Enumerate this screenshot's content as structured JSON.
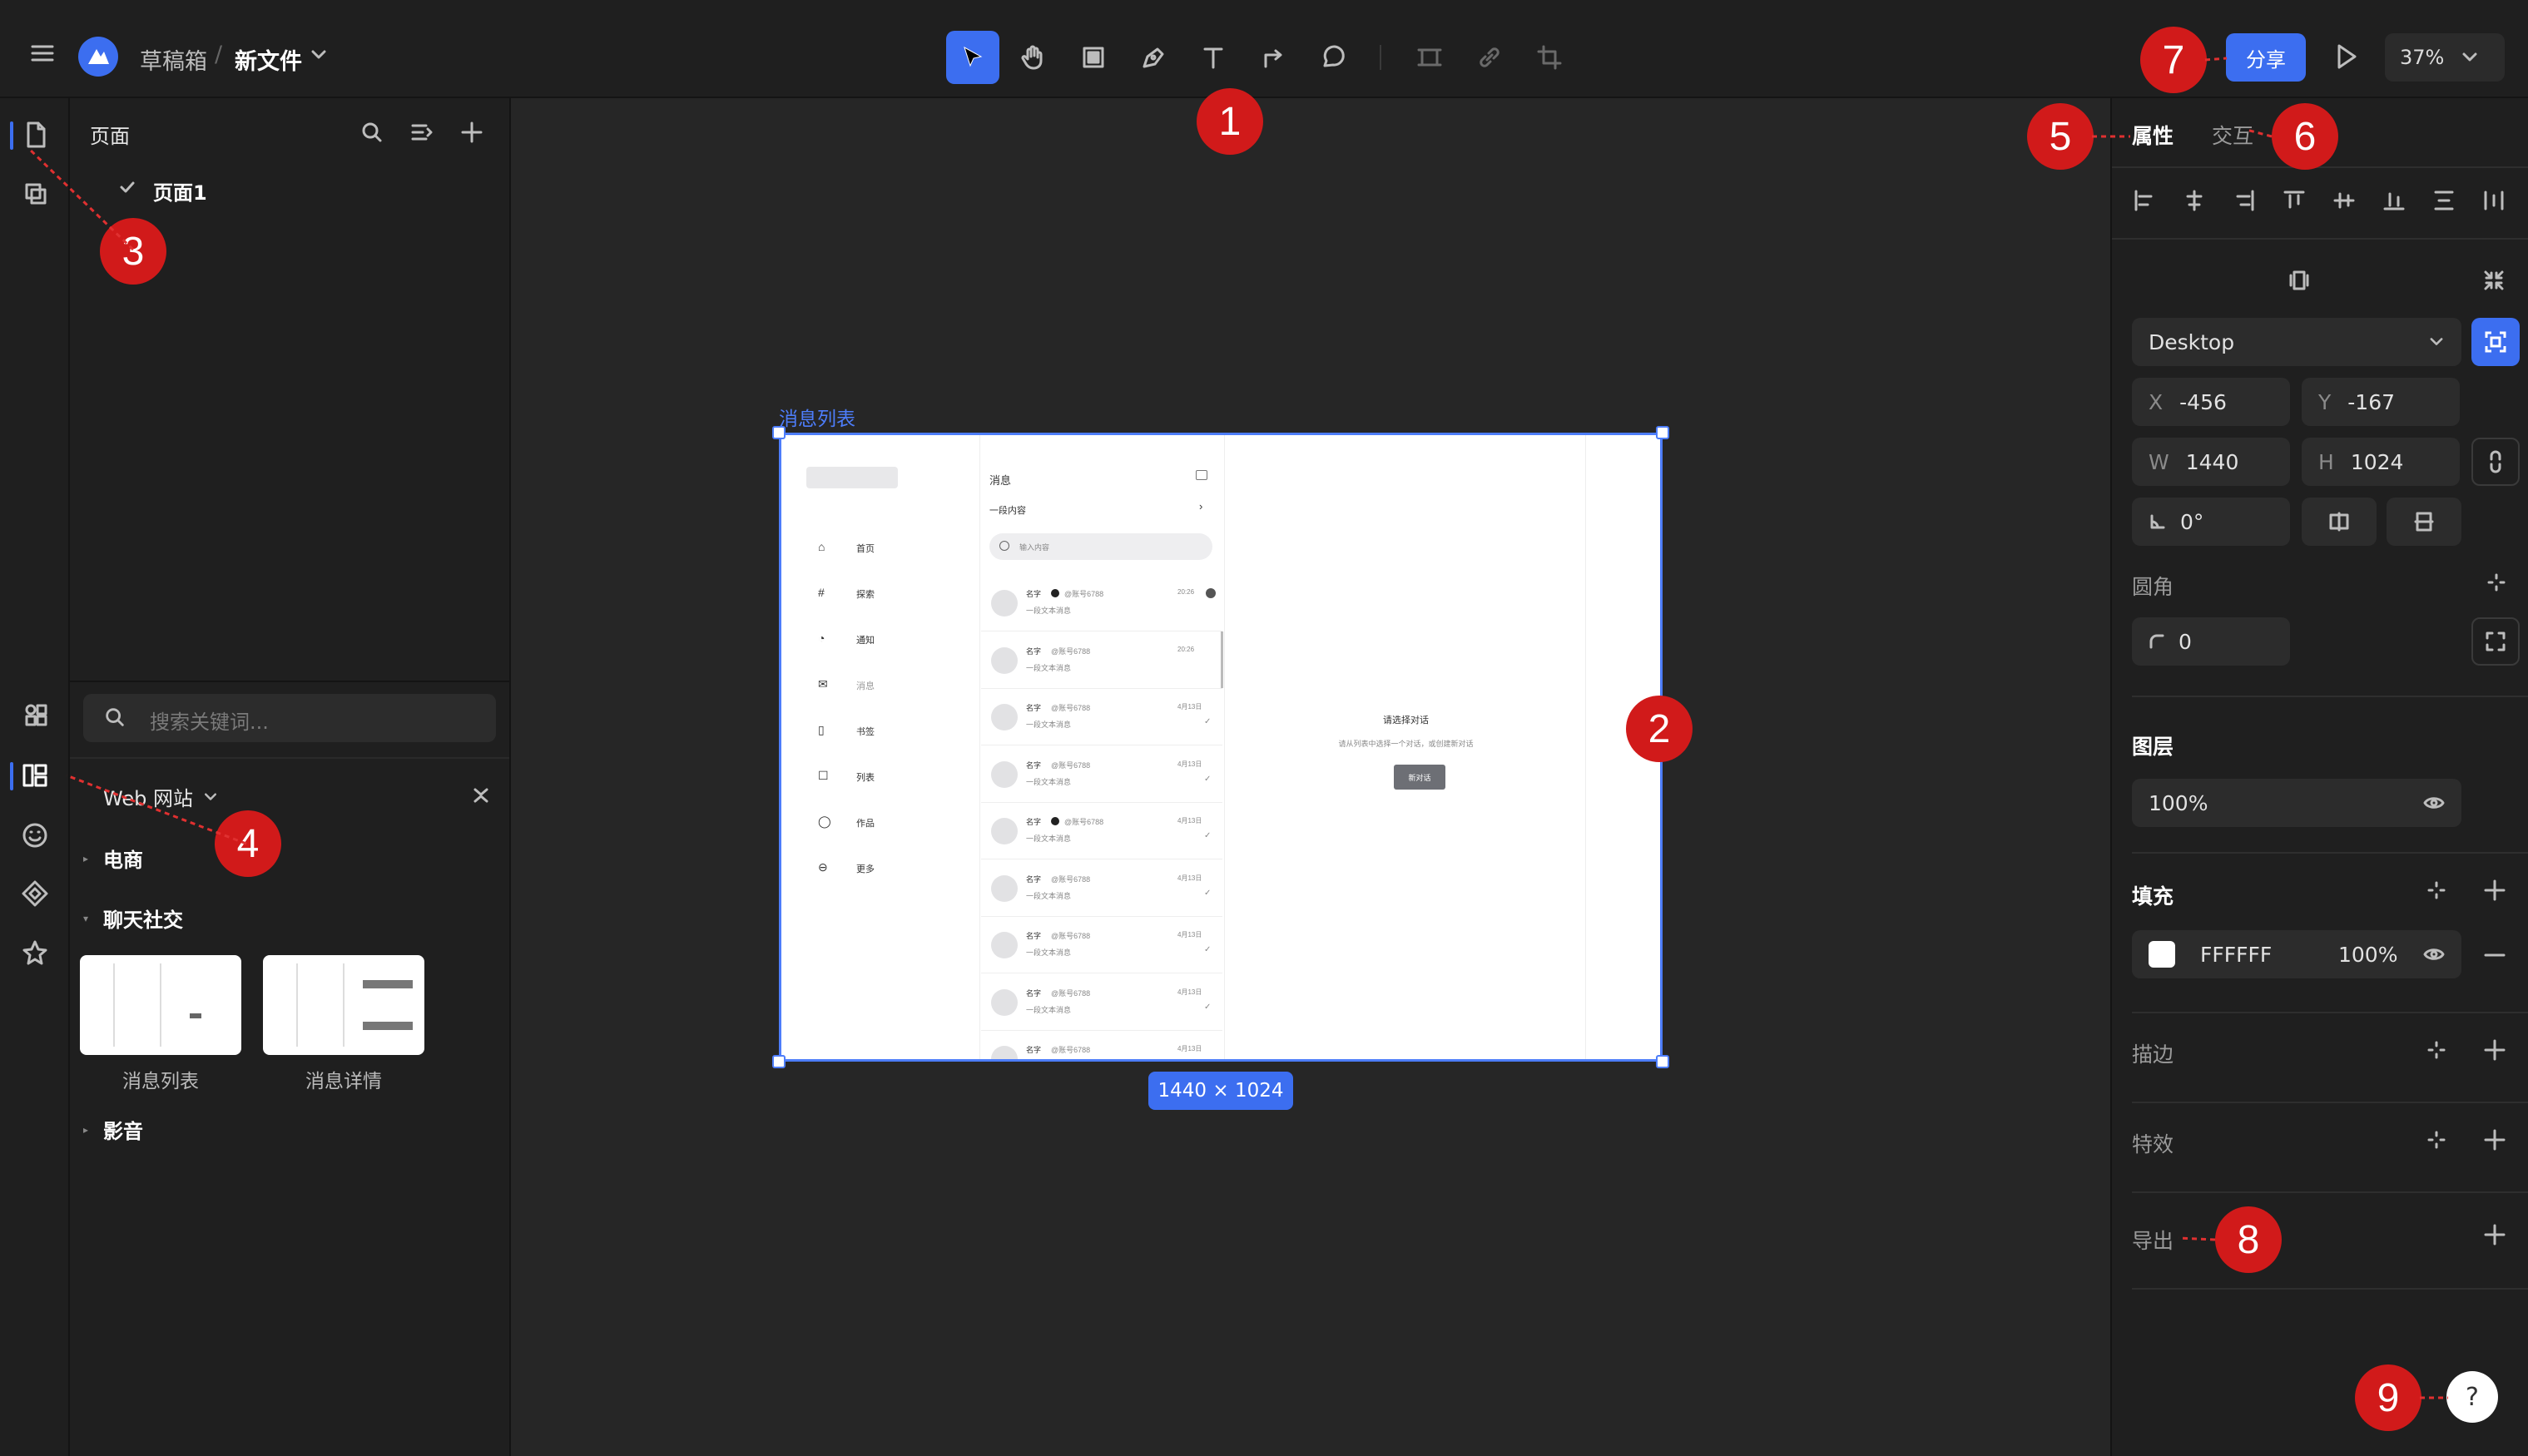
{
  "topbar": {
    "breadcrumb_parent": "草稿箱",
    "breadcrumb_sep": "/",
    "file_name": "新文件",
    "share_label": "分享",
    "zoom": "37%"
  },
  "pages_panel": {
    "title": "页面",
    "page_item": "页面1"
  },
  "assets_panel": {
    "search_placeholder": "搜索关键词...",
    "library": "Web 网站",
    "categories": [
      "电商",
      "聊天社交",
      "影音"
    ],
    "templates": [
      "消息列表",
      "消息详情"
    ]
  },
  "canvas": {
    "frame_label": "消息列表",
    "frame_size": "1440 × 1024",
    "mock": {
      "nav": [
        "首页",
        "探索",
        "通知",
        "消息",
        "书签",
        "列表",
        "作品",
        "更多"
      ],
      "header_title": "消息",
      "subheader": "一段内容",
      "search_placeholder": "输入内容",
      "conv_name": "名字",
      "conv_handle": "@账号6788",
      "conv_snippet": "一段文本消息",
      "conv_times": [
        "20:26",
        "20:26",
        "4月13日",
        "4月13日",
        "4月13日",
        "4月13日",
        "4月13日",
        "4月13日",
        "4月13日"
      ],
      "empty_title": "请选择对话",
      "empty_desc": "请从列表中选择一个对话，或创建新对话",
      "empty_button": "新对话"
    }
  },
  "properties_panel": {
    "tab_properties": "属性",
    "tab_interaction": "交互",
    "device": "Desktop",
    "x_label": "X",
    "x": "-456",
    "y_label": "Y",
    "y": "-167",
    "w_label": "W",
    "w": "1440",
    "h_label": "H",
    "h": "1024",
    "rotation": "0°",
    "radius_title": "圆角",
    "radius": "0",
    "layer_title": "图层",
    "layer_opacity": "100%",
    "fill_title": "填充",
    "fill_hex": "FFFFFF",
    "fill_opacity": "100%",
    "stroke_title": "描边",
    "effects_title": "特效",
    "export_title": "导出"
  },
  "help": {
    "label": "?"
  },
  "annotations": [
    "1",
    "2",
    "3",
    "4",
    "5",
    "6",
    "7",
    "8",
    "9"
  ],
  "colors": {
    "accent": "#3c6ef0",
    "badge": "#d11a1a",
    "panel": "#1f1f1f",
    "canvas": "#262626"
  }
}
